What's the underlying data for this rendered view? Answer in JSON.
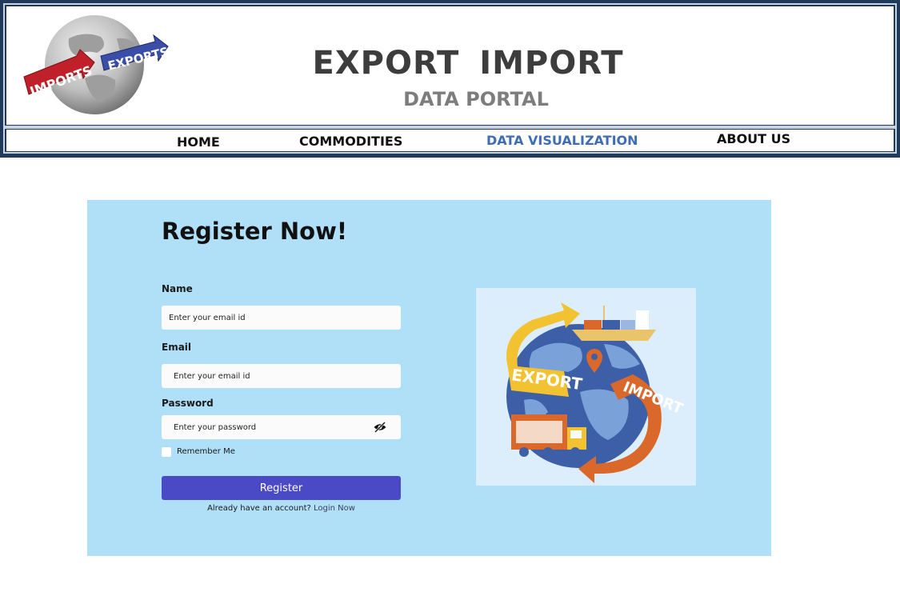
{
  "header": {
    "title": "EXPORT IMPORT",
    "subtitle": "DATA PORTAL",
    "logo": {
      "left_word": "IMPORTS",
      "right_word": "EXPORTS",
      "colors": {
        "imports": "#c0202a",
        "exports": "#3a4ea8",
        "globe": "#c8c8c8"
      }
    }
  },
  "nav": {
    "items": [
      {
        "label": "HOME"
      },
      {
        "label": "COMMODITIES"
      },
      {
        "label": "DATA VISUALIZATION",
        "active": true
      },
      {
        "label": "ABOUT US"
      }
    ]
  },
  "register": {
    "title": "Register Now!",
    "name_label": "Name",
    "name_placeholder": "Enter your email id",
    "email_label": "Email",
    "email_placeholder": "Enter your email id",
    "password_label": "Password",
    "password_placeholder": "Enter your password",
    "remember_label": "Remember Me",
    "button_label": "Register",
    "already_text": "Already have an account?",
    "login_link": "Login Now"
  },
  "illustration": {
    "export_word": "EXPORT",
    "import_word": "IMPORT"
  },
  "colors": {
    "header_frame": "#1f3a5a",
    "panel_bg": "#b0dff8",
    "button": "#4b4ac6",
    "nav_active": "#3e6db6"
  },
  "icons": {
    "password_toggle": "eye-slash-icon"
  }
}
